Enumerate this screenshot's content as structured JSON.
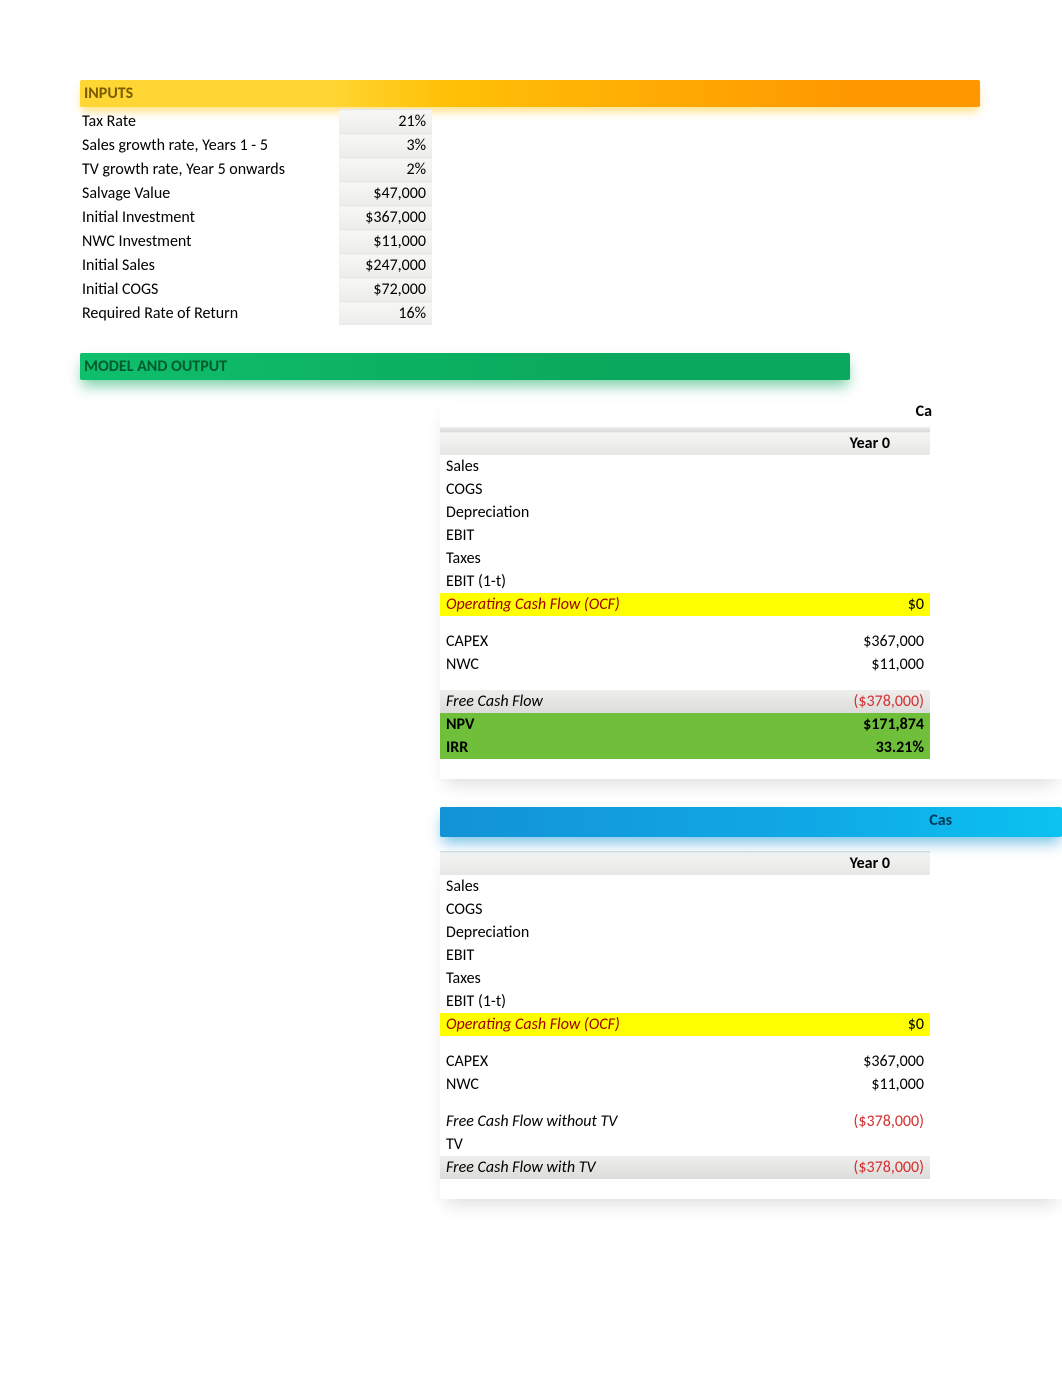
{
  "headers": {
    "inputs": "INPUTS",
    "model": "MODEL AND OUTPUT"
  },
  "inputs": [
    {
      "label": "Tax Rate",
      "value": "21%"
    },
    {
      "label": "Sales growth rate, Years 1 - 5",
      "value": "3%"
    },
    {
      "label": "TV growth rate, Year 5 onwards",
      "value": "2%"
    },
    {
      "label": "Salvage Value",
      "value": "$47,000"
    },
    {
      "label": "Initial Investment",
      "value": "$367,000"
    },
    {
      "label": "NWC Investment",
      "value": "$11,000"
    },
    {
      "label": "Initial Sales",
      "value": "$247,000"
    },
    {
      "label": "Initial COGS",
      "value": "$72,000"
    },
    {
      "label": "Required Rate of Return",
      "value": "16%"
    }
  ],
  "section1": {
    "trunc_title": "Ca",
    "year_label": "Year 0",
    "rows": {
      "sales": "Sales",
      "cogs": "COGS",
      "dep": "Depreciation",
      "ebit": "EBIT",
      "tax": "Taxes",
      "ebit_1t": "EBIT (1-t)",
      "ocf": "Operating Cash Flow (OCF)",
      "ocf_val": "$0",
      "capex": "CAPEX",
      "capex_val": "$367,000",
      "nwc": "NWC",
      "nwc_val": "$11,000",
      "fcf": "Free Cash Flow",
      "fcf_val": "($378,000)",
      "npv": "NPV",
      "npv_val": "$171,874",
      "irr": "IRR",
      "irr_val": "33.21%"
    }
  },
  "section2": {
    "trunc_title": "Cas",
    "year_label": "Year 0",
    "rows": {
      "sales": "Sales",
      "cogs": "COGS",
      "dep": "Depreciation",
      "ebit": "EBIT",
      "tax": "Taxes",
      "ebit_1t": "EBIT (1-t)",
      "ocf": "Operating Cash Flow (OCF)",
      "ocf_val": "$0",
      "capex": "CAPEX",
      "capex_val": "$367,000",
      "nwc": "NWC",
      "nwc_val": "$11,000",
      "fcf_no_tv": "Free Cash Flow without TV",
      "fcf_no_tv_val": "($378,000)",
      "tv": "TV",
      "fcf_tv": "Free Cash Flow with TV",
      "fcf_tv_val": "($378,000)"
    }
  }
}
